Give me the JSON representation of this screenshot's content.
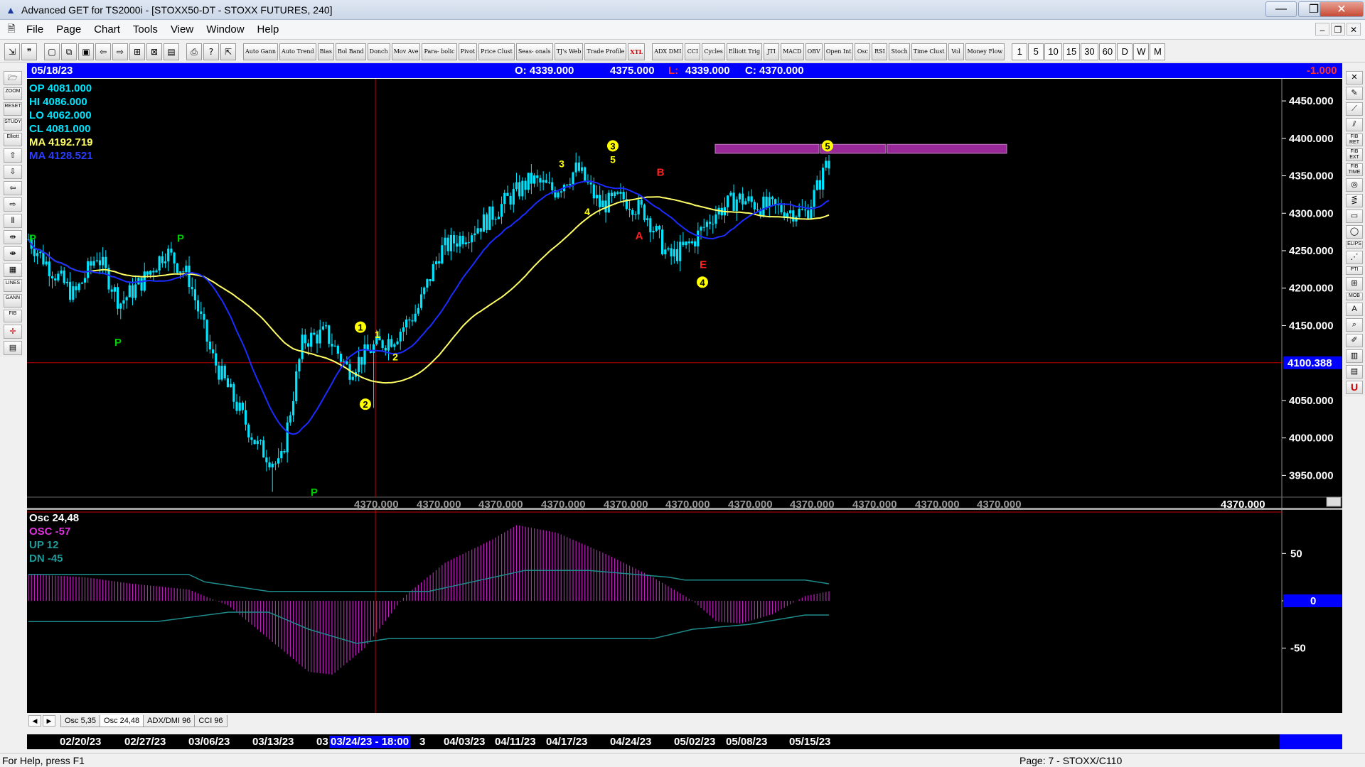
{
  "window": {
    "title": "Advanced GET for TS2000i - [STOXX50-DT - STOXX FUTURES, 240]",
    "minimize": "—",
    "maximize": "❐",
    "close": "✕"
  },
  "menu": [
    "File",
    "Page",
    "Chart",
    "Tools",
    "View",
    "Window",
    "Help"
  ],
  "toolbar": {
    "study_buttons": [
      {
        "id": "auto-gann",
        "label": "Auto Gann"
      },
      {
        "id": "auto-trend",
        "label": "Auto Trend"
      },
      {
        "id": "bias",
        "label": "Bias"
      },
      {
        "id": "bol-band",
        "label": "Bol Band"
      },
      {
        "id": "donch",
        "label": "Donch"
      },
      {
        "id": "mov-ave",
        "label": "Mov Ave"
      },
      {
        "id": "para-bolic",
        "label": "Para- bolic"
      },
      {
        "id": "pivot",
        "label": "Pivot"
      },
      {
        "id": "price-clust",
        "label": "Price Clust"
      },
      {
        "id": "seas-onals",
        "label": "Seas- onals"
      },
      {
        "id": "tjs-web",
        "label": "TJ's Web"
      },
      {
        "id": "trade-profile",
        "label": "Trade Profile"
      },
      {
        "id": "xtl",
        "label": "XTL"
      }
    ],
    "indicator_buttons": [
      {
        "id": "adx-dmi",
        "label": "ADX DMI"
      },
      {
        "id": "cci",
        "label": "CCI"
      },
      {
        "id": "cycles",
        "label": "Cycles"
      },
      {
        "id": "elliott-trig",
        "label": "Elliott Trig"
      },
      {
        "id": "jti",
        "label": "JTI"
      },
      {
        "id": "macd",
        "label": "MACD"
      },
      {
        "id": "obv",
        "label": "OBV"
      },
      {
        "id": "open-int",
        "label": "Open Int"
      },
      {
        "id": "osc",
        "label": "Osc"
      },
      {
        "id": "rsi",
        "label": "RSI"
      },
      {
        "id": "stoch",
        "label": "Stoch"
      },
      {
        "id": "time-clust",
        "label": "Time Clust"
      },
      {
        "id": "vol",
        "label": "Vol"
      },
      {
        "id": "money-flow",
        "label": "Money Flow"
      }
    ],
    "intervals": [
      "1",
      "5",
      "10",
      "15",
      "30",
      "60",
      "D",
      "W",
      "M"
    ]
  },
  "info_bar": {
    "date": "05/18/23",
    "open": "O: 4339.000",
    "high": "4375.000",
    "low_label": "L:",
    "low": "4339.000",
    "close": "C: 4370.000",
    "change": "-1.000"
  },
  "price_legend": {
    "op": "OP  4081.000",
    "hi": "HI   4086.000",
    "lo": "LO  4062.000",
    "cl": "CL  4081.000",
    "ma_yellow": "MA  4192.719",
    "ma_blue": "MA  4128.521"
  },
  "osc_legend": {
    "title": "Osc 24,48",
    "osc": "OSC -57",
    "up": "UP   12",
    "dn": "DN   -45"
  },
  "colors": {
    "background": "#000000",
    "candles": "#00e5ff",
    "ma_yellow": "#ffff66",
    "ma_blue": "#1a2cff",
    "osc_bars": "#c020c0",
    "band_lines": "#1e8c8c",
    "crosshair": "#c00000",
    "elliott_labels": "#ffff00",
    "pivot_labels": "#00cc00",
    "abc_labels": "#ff2020",
    "target_zone": "#9a2a9a",
    "axis_badge": "#0000ff"
  },
  "price_axis": {
    "labels": [
      "4450.000",
      "4400.000",
      "4350.000",
      "4300.000",
      "4250.000",
      "4200.000",
      "4150.000",
      "4100.388",
      "4050.000",
      "4000.000",
      "3950.000"
    ],
    "highlight": "4100.388",
    "bottom_value_label": "4370.000"
  },
  "bottom_repeat_labels": [
    "4370.000",
    "4370.000",
    "4370.000",
    "4370.000",
    "4370.000",
    "4370.000",
    "4370.000",
    "4370.000",
    "4370.000",
    "4370.000",
    "4370.000"
  ],
  "osc_axis": {
    "labels": [
      "50",
      "0",
      "-50"
    ],
    "zero_badge": "0"
  },
  "date_axis": {
    "labels": [
      "02/20/23",
      "02/27/23",
      "03/06/23",
      "03/13/23",
      "03",
      "3",
      "04/03/23",
      "04/11/23",
      "04/17/23",
      "04/24/23",
      "05/02/23",
      "05/08/23",
      "05/15/23"
    ],
    "cursor_label": "03/24/23 - 18:00"
  },
  "pane_tabs": [
    "Osc 5,35",
    "Osc 24,48",
    "ADX/DMI 96",
    "CCI 96"
  ],
  "active_pane_tab": "Osc 24,48",
  "chart_data": {
    "type": "candlestick",
    "symbol": "STOXX50-DT",
    "interval_minutes": 240,
    "y_range": [
      3920,
      4470
    ],
    "approx_closes": [
      4265,
      4225,
      4190,
      4245,
      4180,
      4210,
      4250,
      4215,
      4110,
      4050,
      3990,
      3960,
      4130,
      4140,
      4090,
      4120,
      4135,
      4170,
      4250,
      4270,
      4290,
      4320,
      4345,
      4330,
      4360,
      4310,
      4320,
      4300,
      4240,
      4260,
      4300,
      4320,
      4310,
      4305,
      4300,
      4370
    ],
    "wave_labels": [
      {
        "label": "1",
        "value": 4148,
        "circled": true
      },
      {
        "label": "2",
        "value": 4045,
        "circled": true
      },
      {
        "label": "1",
        "value": 4138,
        "circled": false
      },
      {
        "label": "2",
        "value": 4108,
        "circled": false
      },
      {
        "label": "3",
        "value": 4366,
        "circled": false
      },
      {
        "label": "4",
        "value": 4302,
        "circled": false
      },
      {
        "label": "3",
        "value": 4390,
        "circled": true
      },
      {
        "label": "5",
        "value": 4372,
        "circled": false
      },
      {
        "label": "4",
        "value": 4208,
        "circled": true
      },
      {
        "label": "5",
        "value": 4390,
        "circled": true
      }
    ],
    "pivot_labels": [
      "P",
      "P",
      "P",
      "P"
    ],
    "abc_labels": [
      "A",
      "B",
      "E"
    ],
    "crosshair_price": 4100.388,
    "target_zone": [
      4380,
      4392
    ],
    "oscillator": {
      "name": "Osc 24,48",
      "value": -57,
      "up": 12,
      "dn": -45,
      "y_range": [
        -90,
        90
      ]
    }
  },
  "status": {
    "left": "For Help, press F1",
    "right": "Page: 7 - STOXX/C110"
  }
}
